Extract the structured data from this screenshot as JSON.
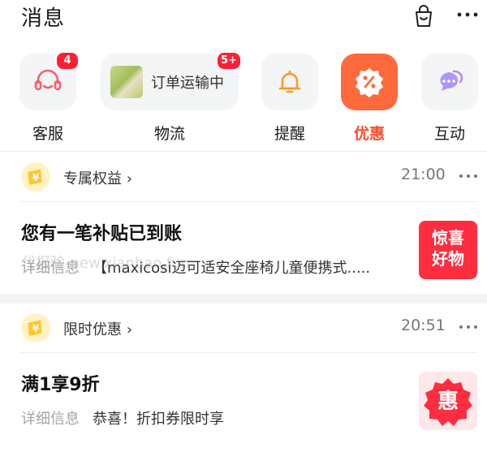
{
  "header": {
    "title": "消息",
    "bag_icon": "shopping-bag-icon",
    "more_icon": "more-icon"
  },
  "categories": [
    {
      "label": "客服",
      "badge": "4",
      "icon": "headset-icon"
    },
    {
      "label": "物流",
      "badge": "5+",
      "status": "订单运输中",
      "icon": "package-thumbnail"
    },
    {
      "label": "提醒",
      "badge": "",
      "icon": "bell-icon"
    },
    {
      "label": "优惠",
      "badge": "",
      "icon": "coupon-icon",
      "active": true
    },
    {
      "label": "互动",
      "badge": "",
      "icon": "chat-icon"
    }
  ],
  "messages": [
    {
      "source": "专属权益",
      "time": "21:00",
      "title": "您有一笔补贴已到账",
      "detail": "详细信息",
      "text": "【maxicosi迈可适安全座椅儿童便携式.....",
      "thumb_text_1": "惊喜",
      "thumb_text_2": "好物",
      "watermark": "代报验-new.xianbao.fun"
    },
    {
      "source": "限时优惠",
      "time": "20:51",
      "title": "满1享9折",
      "detail": "详细信息",
      "text": "恭喜！折扣券限时享",
      "thumb_text": "惠"
    }
  ],
  "colors": {
    "accent": "#ff6a3d",
    "badge": "#ff1f33",
    "coin": "#ffc531"
  }
}
